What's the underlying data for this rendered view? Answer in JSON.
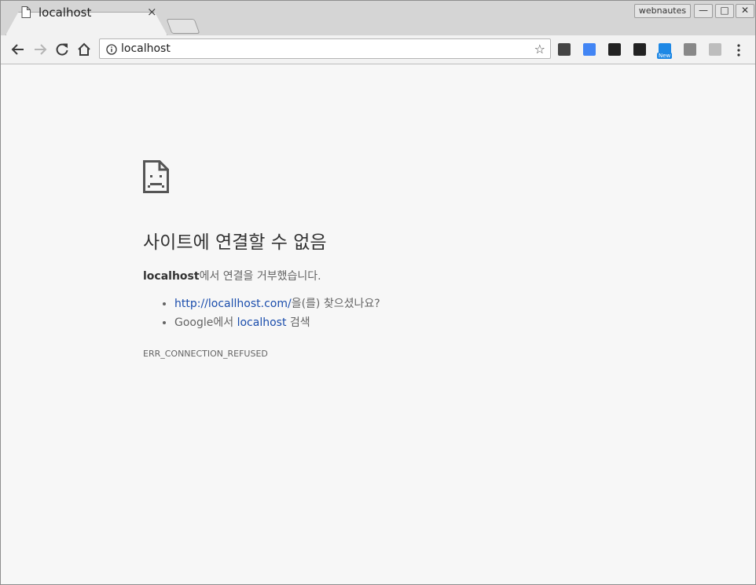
{
  "tab": {
    "title": "localhost",
    "close": "×"
  },
  "titlebar": {
    "profile": "webnautes",
    "minimize": "—",
    "maximize": "□",
    "close": "✕"
  },
  "omnibox": {
    "url": "localhost",
    "star": "☆"
  },
  "extensions": [
    {
      "name": "bulb-extension",
      "color": "#444444"
    },
    {
      "name": "chrome-extension",
      "color": "#4285f4"
    },
    {
      "name": "font-extension",
      "color": "#222222"
    },
    {
      "name": "owl-extension",
      "color": "#222222"
    },
    {
      "name": "dictionary-extension",
      "color": "#1e88e5",
      "badge": "New"
    },
    {
      "name": "chart-extension",
      "color": "#888888"
    },
    {
      "name": "ex-extension",
      "color": "#bdbdbd"
    }
  ],
  "error": {
    "heading": "사이트에 연결할 수 없음",
    "host": "localhost",
    "message_suffix": "에서 연결을 거부했습니다.",
    "suggestion1_link": "http://locallhost.com/",
    "suggestion1_suffix": "을(를) 찾으셨나요?",
    "suggestion2_prefix": "Google에서 ",
    "suggestion2_link": "localhost",
    "suggestion2_suffix": " 검색",
    "code": "ERR_CONNECTION_REFUSED"
  }
}
